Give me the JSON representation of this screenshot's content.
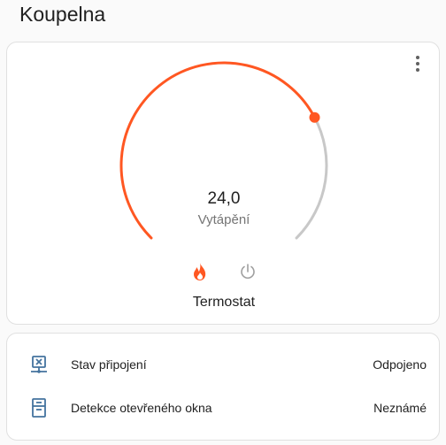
{
  "page": {
    "title": "Koupelna"
  },
  "thermostat": {
    "temperature": "24,0",
    "action": "Vytápění",
    "name": "Termostat",
    "target_fraction": 0.73,
    "modes": [
      {
        "name": "heat",
        "icon": "fire-icon",
        "active": true
      },
      {
        "name": "off",
        "icon": "power-icon",
        "active": false
      }
    ],
    "colors": {
      "heat": "#ff5722",
      "track": "#c8c8c8",
      "inactive_icon": "#9e9e9e"
    }
  },
  "entities": {
    "rows": [
      {
        "label": "Stav připojení",
        "value": "Odpojeno",
        "icon": "network-off-icon"
      },
      {
        "label": "Detekce otevřeného okna",
        "value": "Neznámé",
        "icon": "window-icon"
      }
    ],
    "icon_color": "#44739e"
  }
}
